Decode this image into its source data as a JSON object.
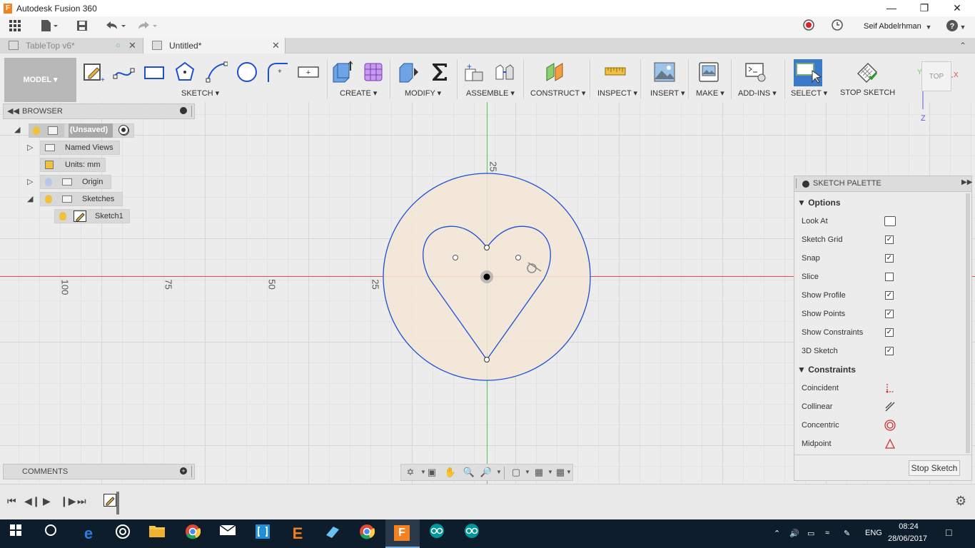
{
  "window": {
    "title": "Autodesk Fusion 360",
    "app_icon": "F"
  },
  "qat": {
    "user": "Seif Abdelrhman",
    "help": "?"
  },
  "tabs": [
    {
      "label": "TableTop v6*"
    },
    {
      "label": "Untitled*"
    }
  ],
  "ribbon": {
    "mode": "MODEL",
    "groups": {
      "sketch": "SKETCH",
      "create": "CREATE",
      "modify": "MODIFY",
      "assemble": "ASSEMBLE",
      "construct": "CONSTRUCT",
      "inspect": "INSPECT",
      "insert": "INSERT",
      "make": "MAKE",
      "addins": "ADD-INS",
      "select": "SELECT",
      "stop_sketch": "STOP SKETCH"
    }
  },
  "viewcube": {
    "face": "TOP",
    "axis_x": "X",
    "axis_y": "Y",
    "axis_z": "Z"
  },
  "browser": {
    "title": "BROWSER",
    "items": [
      {
        "label": "(Unsaved)"
      },
      {
        "label": "Named Views"
      },
      {
        "label": "Units: mm"
      },
      {
        "label": "Origin"
      },
      {
        "label": "Sketches"
      },
      {
        "label": "Sketch1"
      }
    ]
  },
  "comments": {
    "title": "COMMENTS"
  },
  "ruler": {
    "top": "25",
    "left1": "25",
    "left2": "50",
    "left3": "75",
    "left4": "100"
  },
  "palette": {
    "title": "SKETCH PALETTE",
    "options_title": "Options",
    "options": [
      {
        "label": "Look At",
        "kind": "button"
      },
      {
        "label": "Sketch Grid",
        "checked": true
      },
      {
        "label": "Snap",
        "checked": true
      },
      {
        "label": "Slice",
        "checked": false
      },
      {
        "label": "Show Profile",
        "checked": true
      },
      {
        "label": "Show Points",
        "checked": true
      },
      {
        "label": "Show Constraints",
        "checked": true
      },
      {
        "label": "3D Sketch",
        "checked": true
      }
    ],
    "constraints_title": "Constraints",
    "constraints": [
      {
        "label": "Coincident"
      },
      {
        "label": "Collinear"
      },
      {
        "label": "Concentric"
      },
      {
        "label": "Midpoint"
      }
    ],
    "stop_button": "Stop Sketch"
  },
  "taskbar": {
    "lang": "ENG",
    "time": "08:24",
    "date": "28/06/2017"
  },
  "colors": {
    "accent_blue": "#1a4fd6",
    "profile_fill": "#f5e6d6",
    "axis_red": "#e05050",
    "axis_green": "#55c455"
  }
}
